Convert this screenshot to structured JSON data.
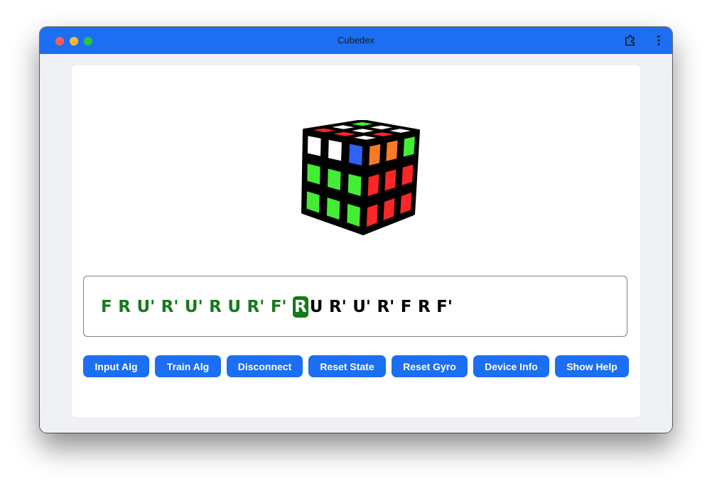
{
  "window": {
    "title": "Cubedex"
  },
  "toolbar": {
    "extensions_icon": "puzzle-piece-icon",
    "menu_icon": "kebab-menu-icon"
  },
  "cube": {
    "faces": {
      "up": [
        [
          "red",
          "white",
          "green"
        ],
        [
          "red",
          "white",
          "white"
        ],
        [
          "white",
          "red",
          "white"
        ]
      ],
      "front": [
        [
          "white",
          "white",
          "blue"
        ],
        [
          "green",
          "green",
          "green"
        ],
        [
          "green",
          "green",
          "green"
        ]
      ],
      "right": [
        [
          "orange",
          "orange",
          "green"
        ],
        [
          "red",
          "red",
          "red"
        ],
        [
          "red",
          "red",
          "red"
        ]
      ]
    },
    "colors": {
      "white": "#ffffff",
      "green": "#45ec35",
      "red": "#fc2626",
      "blue": "#2d63f3",
      "orange": "#f77b25"
    }
  },
  "algorithm": {
    "moves": [
      {
        "text": "F",
        "state": "done"
      },
      {
        "text": "R",
        "state": "done"
      },
      {
        "text": "U'",
        "state": "done"
      },
      {
        "text": "R'",
        "state": "done"
      },
      {
        "text": "U'",
        "state": "done"
      },
      {
        "text": "R",
        "state": "done"
      },
      {
        "text": "U",
        "state": "done"
      },
      {
        "text": "R'",
        "state": "done"
      },
      {
        "text": "F'",
        "state": "done"
      },
      {
        "text": "R",
        "state": "current"
      },
      {
        "text": "U",
        "state": "todo"
      },
      {
        "text": "R'",
        "state": "todo"
      },
      {
        "text": "U'",
        "state": "todo"
      },
      {
        "text": "R'",
        "state": "todo"
      },
      {
        "text": "F",
        "state": "todo"
      },
      {
        "text": "R",
        "state": "todo"
      },
      {
        "text": "F'",
        "state": "todo"
      }
    ],
    "done_color": "#157a1a"
  },
  "buttons": {
    "input_alg": "Input Alg",
    "train_alg": "Train Alg",
    "disconnect": "Disconnect",
    "reset_state": "Reset State",
    "reset_gyro": "Reset Gyro",
    "device_info": "Device Info",
    "show_help": "Show Help"
  },
  "theme": {
    "accent": "#1c6ef2",
    "background": "#eef0f4"
  }
}
